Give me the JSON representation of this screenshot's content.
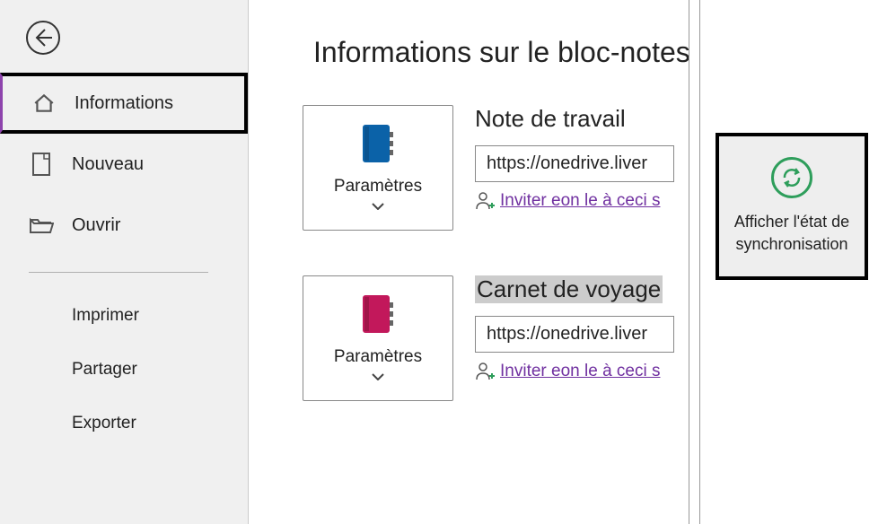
{
  "sidebar": {
    "items": [
      {
        "label": "Informations"
      },
      {
        "label": "Nouveau"
      },
      {
        "label": "Ouvrir"
      }
    ],
    "subitems": [
      {
        "label": "Imprimer"
      },
      {
        "label": "Partager"
      },
      {
        "label": "Exporter"
      }
    ]
  },
  "page": {
    "title": "Informations sur le bloc-notes"
  },
  "notebooks": [
    {
      "title": "Note de travail",
      "url": "https://onedrive.liver",
      "invite": "Inviter eon le à ceci s",
      "settings_label": "Paramètres",
      "color": "#0b62a8"
    },
    {
      "title": "Carnet de voyage",
      "url": "https://onedrive.liver",
      "invite": "Inviter eon le à ceci s",
      "settings_label": "Paramètres",
      "color": "#c2185b"
    }
  ],
  "sync_button": {
    "label": "Afficher l'état de synchronisation"
  }
}
